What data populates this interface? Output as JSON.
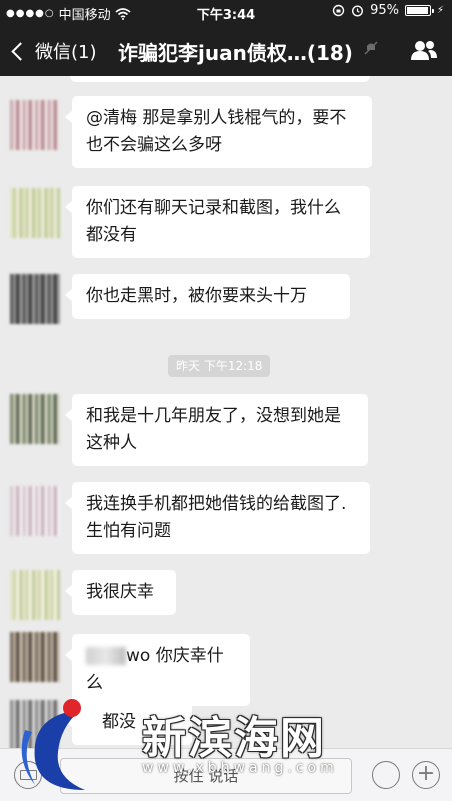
{
  "status_bar": {
    "carrier": "中国移动",
    "time": "下午3:44",
    "battery": "95%",
    "battery_level": 0.95
  },
  "nav": {
    "back_label": "微信(1)",
    "title": "诈骗犯李juan债权…(18)"
  },
  "messages": [
    {
      "text": "@清梅 那是拿别人钱棍气的，要不也不会骗这么多呀"
    },
    {
      "text": "你们还有聊天记录和截图，我什么都没有"
    },
    {
      "text": "你也走黑时，被你要来头十万"
    },
    {
      "text": "和我是十几年朋友了，没想到她是这种人"
    },
    {
      "text": "我连换手机都把她借钱的给截图了.生怕有问题"
    },
    {
      "text": "我很庆幸"
    },
    {
      "text": "wo 你庆幸什么"
    },
    {
      "text": "都没"
    }
  ],
  "timestamp": "昨天 下午12:18",
  "input_bar": {
    "talk_label": "按住 说话"
  },
  "watermark": {
    "text": "新滨海网",
    "url": "www.xbhwang.com"
  },
  "icons": {
    "back": "chevron-left-icon",
    "mute": "mute-icon",
    "group": "group-members-icon",
    "keyboard": "keyboard-icon",
    "emoji": "emoji-icon",
    "plus": "plus-icon"
  }
}
